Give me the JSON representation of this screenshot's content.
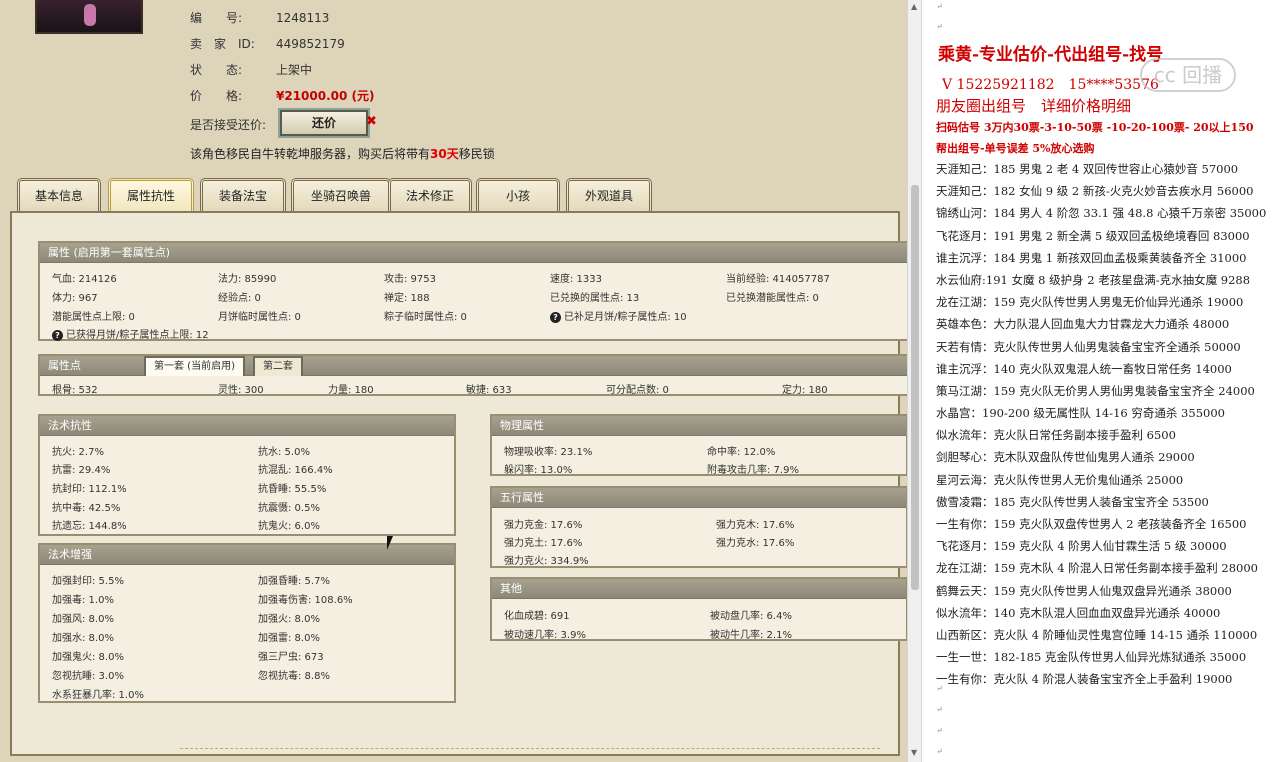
{
  "listing": {
    "id_label": "编　　号:",
    "id_value": "1248113",
    "seller_label": "卖　家　ID:",
    "seller_value": "449852179",
    "status_label": "状　　态:",
    "status_value": "上架中",
    "price_label": "价　　格:",
    "price_value": "¥21000.00 (元)",
    "offer_label": "是否接受还价:",
    "offer_button": "还价",
    "offer_x": "✖",
    "migrate_pre": "该角色移民自牛转乾坤服务器，购买后将带有",
    "migrate_days": "30天",
    "migrate_post": "移民锁"
  },
  "tabs": [
    "基本信息",
    "属性抗性",
    "装备法宝",
    "坐骑召唤兽",
    "法术修正",
    "小孩",
    "外观道具"
  ],
  "attr": {
    "header": "属性 (启用第一套属性点)",
    "rows": [
      [
        "气血: 214126",
        "法力: 85990",
        "攻击: 9753",
        "速度: 1333",
        "当前经验: 414057787"
      ],
      [
        "体力: 967",
        "经验点: 0",
        "禅定: 188",
        "已兑换的属性点: 13",
        "已兑换潜能属性点: 0"
      ],
      [
        "潜能属性点上限: 0",
        "月饼临时属性点: 0",
        "粽子临时属性点: 0",
        "已补足月饼/粽子属性点: 10",
        ""
      ]
    ],
    "note": "已获得月饼/粽子属性点上限: 12"
  },
  "points": {
    "header": "属性点",
    "tab1": "第一套 (当前启用)",
    "tab2": "第二套",
    "items": [
      "根骨: 532",
      "灵性: 300",
      "力量: 180",
      "敏捷: 633",
      "可分配点数: 0",
      "定力: 180"
    ]
  },
  "resist": {
    "header": "法术抗性",
    "items": [
      "抗火: 2.7%",
      "抗水: 5.0%",
      "抗雷: 29.4%",
      "抗混乱: 166.4%",
      "抗封印: 112.1%",
      "抗昏睡: 55.5%",
      "抗中毒: 42.5%",
      "抗震慑: 0.5%",
      "抗遗忘: 144.8%",
      "抗鬼火: 6.0%"
    ]
  },
  "boost": {
    "header": "法术增强",
    "items": [
      "加强封印: 5.5%",
      "加强昏睡: 5.7%",
      "加强毒: 1.0%",
      "加强毒伤害: 108.6%",
      "加强风: 8.0%",
      "加强火: 8.0%",
      "加强水: 8.0%",
      "加强雷: 8.0%",
      "加强鬼火: 8.0%",
      "强三尸虫: 673",
      "忽视抗睡: 3.0%",
      "忽视抗毒: 8.8%",
      "水系狂暴几率: 1.0%",
      ""
    ]
  },
  "physical": {
    "header": "物理属性",
    "items": [
      "物理吸收率: 23.1%",
      "命中率: 12.0%",
      "躲闪率: 13.0%",
      "附毒攻击几率: 7.9%"
    ]
  },
  "five": {
    "header": "五行属性",
    "items": [
      "强力克金: 17.6%",
      "强力克木: 17.6%",
      "强力克土: 17.6%",
      "强力克水: 17.6%",
      "强力克火: 334.9%",
      ""
    ]
  },
  "other": {
    "header": "其他",
    "items": [
      "化血成碧: 691",
      "被动盘几率: 6.4%",
      "被动速几率: 3.9%",
      "被动牛几率: 2.1%"
    ]
  },
  "doc": {
    "title": "乘黄-专业估价-代出组号-找号",
    "phone": "V 15225921182　15****53576",
    "line2": "朋友圈出组号　详细价格明细",
    "line3": "扫码估号 3万内30票-3-10-50票 -10-20-100票- 20以上150",
    "line4": "帮出组号-单号误差 5%放心选购",
    "pm": "↵",
    "entries": [
      "天涯知己：185 男鬼 2 老 4 双回传世容止心猿妙音 57000",
      "天涯知己：182 女仙 9 级 2 新孩-火克火妙音去疾水月 56000",
      "锦绣山河：184 男人 4 阶忽 33.1 强 48.8 心猿千万亲密 35000",
      "飞花逐月：191 男鬼 2 新全满 5 级双回孟极绝境春回 83000",
      "谁主沉浮：184 男鬼 1 新孩双回血孟极乘黄装备齐全 31000",
      "水云仙府:191 女魔 8 级护身 2 老孩星盘满-克水抽女魔 9288",
      "龙在江湖：159 克火队传世男人男鬼无价仙异光通杀 19000",
      "英雄本色：大力队混人回血鬼大力甘霖龙大力通杀 48000",
      "天若有情：克火队传世男人仙男鬼装备宝宝齐全通杀 50000",
      "谁主沉浮：140 克火队双鬼混人统一畜牧日常任务 14000",
      "策马江湖：159 克火队无价男人男仙男鬼装备宝宝齐全 24000",
      "水晶宫：190-200 级无属性队 14-16 穷奇通杀 355000",
      "似水流年：克火队日常任务副本接手盈利 6500",
      "剑胆琴心：克木队双盘队传世仙鬼男人通杀 29000",
      "星河云海：克火队传世男人无价鬼仙通杀 25000",
      "傲雪凌霜：185 克火队传世男人装备宝宝齐全 53500",
      "一生有你：159 克火队双盘传世男人 2 老孩装备齐全 16500",
      "飞花逐月：159 克火队 4 阶男人仙甘霖生活 5 级 30000",
      "龙在江湖：159 克木队 4 阶混人日常任务副本接手盈利 28000",
      "鹤舞云天：159 克火队传世男人仙鬼双盘异光通杀 38000",
      "似水流年：140 克木队混人回血血双盘异光通杀 40000",
      "山西新区：克火队 4 阶睡仙灵性鬼宫位睡 14-15 通杀 110000",
      "一生一世：182-185 克金队传世男人仙异光炼狱通杀 35000",
      "一生有你：克火队 4 阶混人装备宝宝齐全上手盈利 19000"
    ]
  },
  "watermark": "cc 回播"
}
